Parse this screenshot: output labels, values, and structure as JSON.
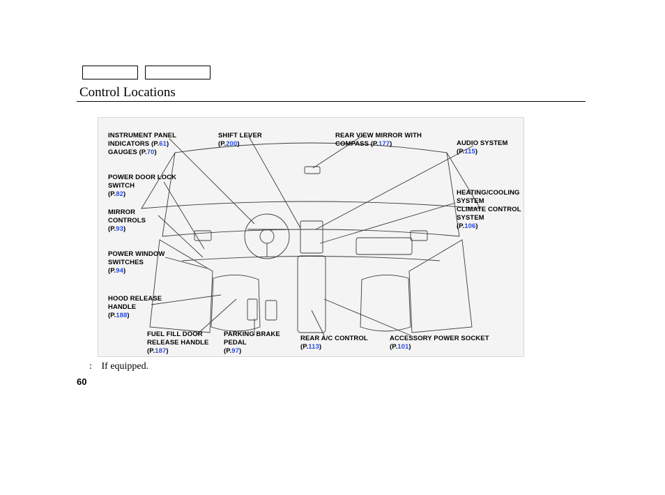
{
  "title": "Control Locations",
  "page_number": "60",
  "footnote_marker": ":",
  "footnote_text": "If equipped.",
  "labels": {
    "instrument_panel": {
      "l1": "INSTRUMENT PANEL",
      "l2_a": "INDICATORS (P.",
      "l2_b": "61",
      "l2_c": ")",
      "l3_a": "GAUGES (P.",
      "l3_b": "70",
      "l3_c": ")"
    },
    "power_door_lock": {
      "l1": "POWER DOOR LOCK",
      "l2": "SWITCH",
      "ref_a": "(P.",
      "ref_b": "82",
      "ref_c": ")"
    },
    "mirror_controls": {
      "l1": "MIRROR",
      "l2": "CONTROLS",
      "ref_a": "(P.",
      "ref_b": "93",
      "ref_c": ")"
    },
    "power_window": {
      "l1": "POWER WINDOW",
      "l2": "SWITCHES",
      "ref_a": "(P.",
      "ref_b": "94",
      "ref_c": ")"
    },
    "hood_release": {
      "l1": "HOOD RELEASE",
      "l2": "HANDLE",
      "ref_a": "(P.",
      "ref_b": "188",
      "ref_c": ")"
    },
    "fuel_fill": {
      "l1": "FUEL FILL DOOR",
      "l2": "RELEASE HANDLE",
      "ref_a": "(P.",
      "ref_b": "187",
      "ref_c": ")"
    },
    "parking_brake": {
      "l1": "PARKING BRAKE",
      "l2": "PEDAL",
      "ref_a": "(P.",
      "ref_b": "97",
      "ref_c": ")"
    },
    "rear_ac": {
      "l1": "REAR A/C CONTROL",
      "ref_a": "(P.",
      "ref_b": "113",
      "ref_c": ")"
    },
    "accessory_socket": {
      "l1": "ACCESSORY POWER SOCKET",
      "ref_a": "(P.",
      "ref_b": "101",
      "ref_c": ")"
    },
    "shift_lever": {
      "l1": "SHIFT LEVER",
      "ref_a": "(P.",
      "ref_b": "200",
      "ref_c": ")"
    },
    "rear_view_mirror": {
      "l1": "REAR VIEW MIRROR WITH",
      "l2_a": "COMPASS",
      "l2_b": "   (P.",
      "l2_c": "177",
      "l2_d": ")"
    },
    "audio_system": {
      "l1": "AUDIO SYSTEM",
      "ref_a": "(P.",
      "ref_b": "115",
      "ref_c": ")"
    },
    "heating_cooling": {
      "l1": "HEATING/COOLING",
      "l2": "SYSTEM",
      "l3": "CLIMATE CONTROL",
      "l4": "SYSTEM",
      "ref_a": "(P.",
      "ref_b": "106",
      "ref_c": ")"
    }
  }
}
